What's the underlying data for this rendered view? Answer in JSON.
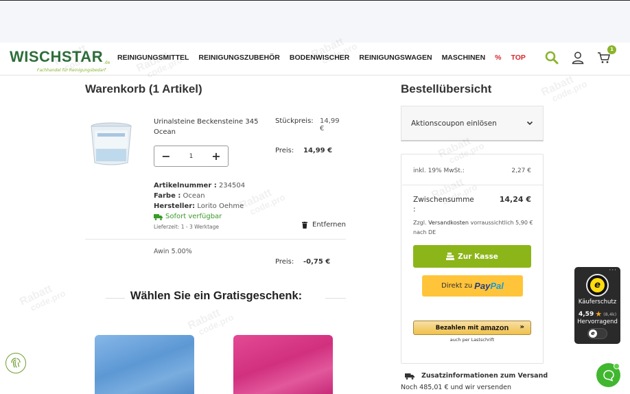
{
  "header": {
    "logo_main": "WISCHSTAR",
    "logo_sup": ".de",
    "logo_tagline_a": "Fachhandel für",
    "logo_tagline_b": "Reinigungsbedarf",
    "nav": [
      "REINIGUNGSMITTEL",
      "REINIGUNGSZUBEHÖR",
      "BODENWISCHER",
      "REINIGUNGSWAGEN",
      "MASCHINEN",
      "%",
      "TOP"
    ],
    "cart_count": "1",
    "accent_color": "#8ab42c",
    "icons": [
      "search-icon",
      "user-icon",
      "cart-icon"
    ]
  },
  "cart": {
    "title": "Warenkorb (1 Artikel)",
    "product": {
      "name": "Urinalsteine Beckensteine 345 Ocean",
      "unit_price_label": "Stückpreis:",
      "unit_price": "14,99 €",
      "quantity": "1",
      "price_label": "Preis:",
      "price": "14,99 €",
      "article_no_label": "Artikelnummer :",
      "article_no": "234504",
      "color_label": "Farbe :",
      "color": "Ocean",
      "manufacturer_label": "Hersteller:",
      "manufacturer": "Lorito Oehme",
      "availability": "Sofort verfügbar",
      "delivery": "Lieferzeit: 1 - 3 Werktage",
      "remove_label": "Entfernen"
    },
    "discount": {
      "name": "Awin 5.00%",
      "price_label": "Preis:",
      "price": "-0,75 €"
    },
    "gift_title": "Wählen Sie ein Gratisgeschenk:"
  },
  "summary": {
    "title": "Bestellübersicht",
    "coupon_label": "Aktionscoupon einlösen",
    "vat_label": "inkl. 19% MwSt.:",
    "vat_value": "2,27 €",
    "subtotal_label": "Zwischensumme",
    "subtotal_colon": ":",
    "subtotal_value": "14,24 €",
    "shipping_note_a": "Zzgl.",
    "shipping_note_b": "Versandkosten",
    "shipping_note_c": "vorraussichtlich 5,90 € nach DE",
    "checkout_label": "Zur Kasse",
    "paypal_prefix": "Direkt zu",
    "paypal_a": "Pay",
    "paypal_b": "Pal",
    "amazon_prefix": "Bezahlen mit",
    "amazon_brand": "amazon",
    "amazon_sub": "auch per Lastschrift",
    "shipping_info_title": "Zusatzinformationen zum Versand",
    "shipping_info_text": "Noch 485,01 € und wir versenden"
  },
  "trusted_shops": {
    "label": "Käuferschutz",
    "rating": "4,59",
    "count": "(8,4k)",
    "grade": "Hervorragend"
  },
  "watermark": {
    "line1": "Rabatt",
    "line2": "code.pro"
  }
}
